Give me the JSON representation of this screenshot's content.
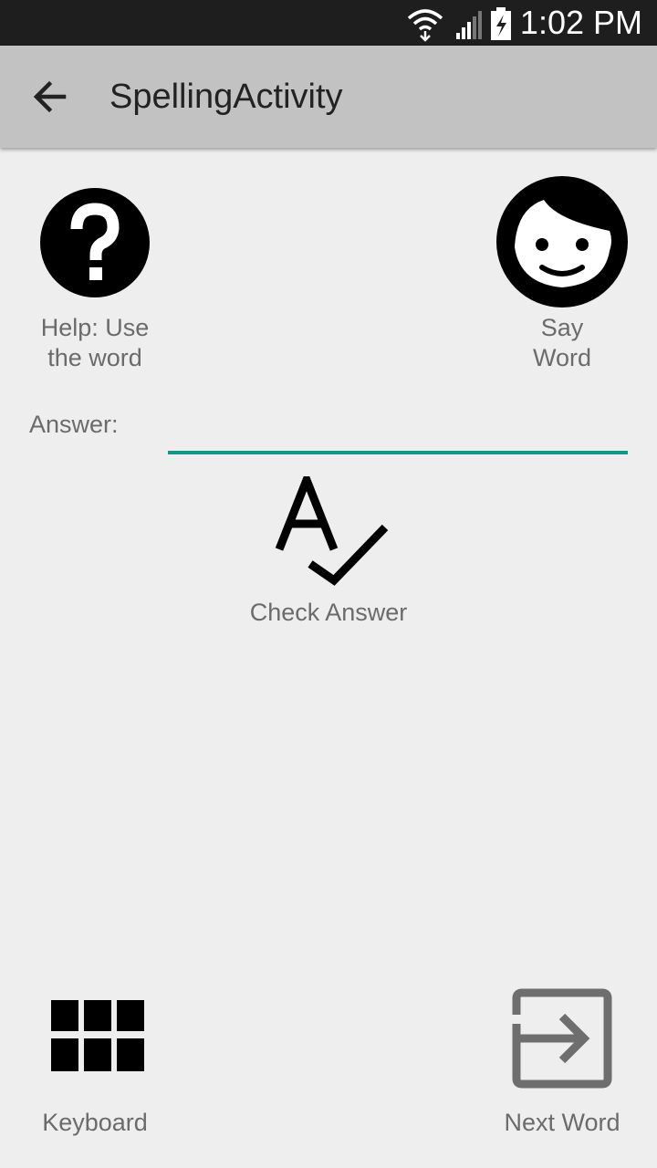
{
  "status_bar": {
    "time": "1:02 PM",
    "icons": [
      "wifi-icon",
      "signal-icon",
      "battery-charging-icon"
    ]
  },
  "app_bar": {
    "title": "SpellingActivity",
    "back_icon": "arrow-left-icon"
  },
  "help_button": {
    "label_line1": "Help: Use",
    "label_line2": "the word",
    "icon": "question-icon"
  },
  "say_word_button": {
    "label_line1": "Say",
    "label_line2": "Word",
    "icon": "face-icon"
  },
  "answer": {
    "label": "Answer:",
    "value": "",
    "accent_color": "#12968a"
  },
  "check_answer_button": {
    "label": "Check Answer",
    "icon": "spellcheck-icon"
  },
  "keyboard_button": {
    "label": "Keyboard",
    "icon": "grid-icon"
  },
  "next_word_button": {
    "label": "Next Word",
    "icon": "exit-arrow-icon"
  },
  "colors": {
    "background": "#eeeeee",
    "app_bar": "#c2c2c2",
    "status_bar": "#1e1e1e",
    "label_text": "#6b6b6b"
  }
}
